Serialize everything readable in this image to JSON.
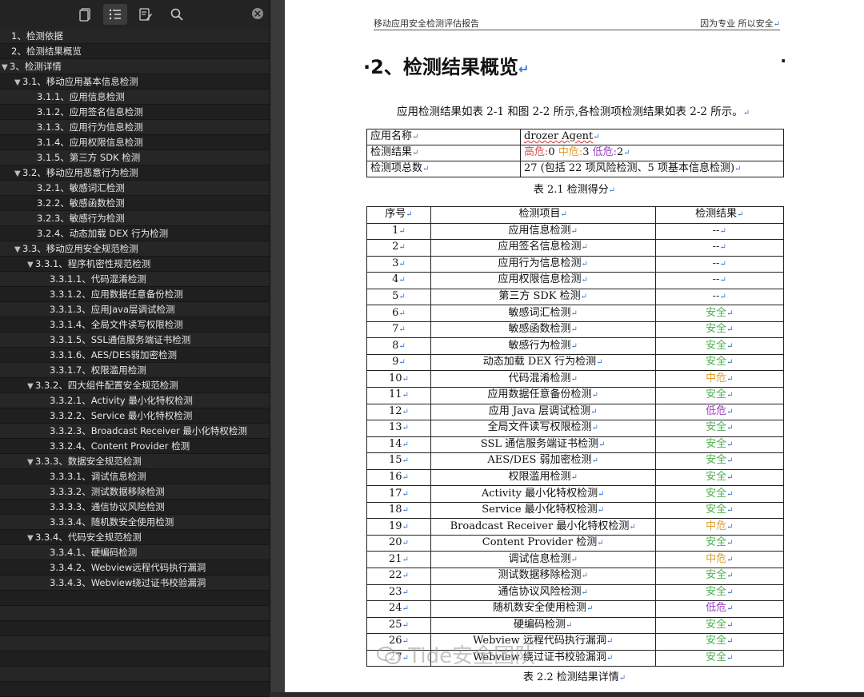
{
  "toolbar": {
    "icons": [
      "thumbnails-icon",
      "outline-icon",
      "annotations-icon",
      "search-icon"
    ],
    "active": "outline-icon"
  },
  "outline": [
    {
      "label": "1、检测依据",
      "level": 0,
      "caret": ""
    },
    {
      "label": "2、检测结果概览",
      "level": 0,
      "caret": ""
    },
    {
      "label": "3、检测详情",
      "level": 0,
      "caret": "▼"
    },
    {
      "label": "3.1、移动应用基本信息检测",
      "level": 1,
      "caret": "▼"
    },
    {
      "label": "3.1.1、应用信息检测",
      "level": 2,
      "caret": ""
    },
    {
      "label": "3.1.2、应用签名信息检测",
      "level": 2,
      "caret": ""
    },
    {
      "label": "3.1.3、应用行为信息检测",
      "level": 2,
      "caret": ""
    },
    {
      "label": "3.1.4、应用权限信息检测",
      "level": 2,
      "caret": ""
    },
    {
      "label": "3.1.5、第三方 SDK 检测",
      "level": 2,
      "caret": ""
    },
    {
      "label": "3.2、移动应用恶意行为检测",
      "level": 1,
      "caret": "▼"
    },
    {
      "label": "3.2.1、敏感词汇检测",
      "level": 2,
      "caret": ""
    },
    {
      "label": "3.2.2、敏感函数检测",
      "level": 2,
      "caret": ""
    },
    {
      "label": "3.2.3、敏感行为检测",
      "level": 2,
      "caret": ""
    },
    {
      "label": "3.2.4、动态加载 DEX 行为检测",
      "level": 2,
      "caret": ""
    },
    {
      "label": "3.3、移动应用安全规范检测",
      "level": 1,
      "caret": "▼"
    },
    {
      "label": "3.3.1、程序机密性规范检测",
      "level": 2,
      "caret": "▼"
    },
    {
      "label": "3.3.1.1、代码混淆检测",
      "level": 3,
      "caret": ""
    },
    {
      "label": "3.3.1.2、应用数据任意备份检测",
      "level": 3,
      "caret": ""
    },
    {
      "label": "3.3.1.3、应用Java层调试检测",
      "level": 3,
      "caret": ""
    },
    {
      "label": "3.3.1.4、全局文件读写权限检测",
      "level": 3,
      "caret": ""
    },
    {
      "label": "3.3.1.5、SSL通信服务端证书检测",
      "level": 3,
      "caret": ""
    },
    {
      "label": "3.3.1.6、AES/DES弱加密检测",
      "level": 3,
      "caret": ""
    },
    {
      "label": "3.3.1.7、权限滥用检测",
      "level": 3,
      "caret": ""
    },
    {
      "label": "3.3.2、四大组件配置安全规范检测",
      "level": 2,
      "caret": "▼"
    },
    {
      "label": "3.3.2.1、Activity 最小化特权检测",
      "level": 3,
      "caret": ""
    },
    {
      "label": "3.3.2.2、Service 最小化特权检测",
      "level": 3,
      "caret": ""
    },
    {
      "label": "3.3.2.3、Broadcast Receiver 最小化特权检测",
      "level": 3,
      "caret": ""
    },
    {
      "label": "3.3.2.4、Content Provider 检测",
      "level": 3,
      "caret": ""
    },
    {
      "label": "3.3.3、数据安全规范检测",
      "level": 2,
      "caret": "▼"
    },
    {
      "label": "3.3.3.1、调试信息检测",
      "level": 3,
      "caret": ""
    },
    {
      "label": "3.3.3.2、测试数据移除检测",
      "level": 3,
      "caret": ""
    },
    {
      "label": "3.3.3.3、通信协议风险检测",
      "level": 3,
      "caret": ""
    },
    {
      "label": "3.3.3.4、随机数安全使用检测",
      "level": 3,
      "caret": ""
    },
    {
      "label": "3.3.4、代码安全规范检测",
      "level": 2,
      "caret": "▼"
    },
    {
      "label": "3.3.4.1、硬编码检测",
      "level": 3,
      "caret": ""
    },
    {
      "label": "3.3.4.2、Webview远程代码执行漏洞",
      "level": 3,
      "caret": ""
    },
    {
      "label": "3.3.4.3、Webview绕过证书校验漏洞",
      "level": 3,
      "caret": ""
    },
    {
      "label": "",
      "level": 0,
      "caret": ""
    },
    {
      "label": "",
      "level": 0,
      "caret": ""
    },
    {
      "label": "",
      "level": 0,
      "caret": ""
    },
    {
      "label": "",
      "level": 0,
      "caret": ""
    },
    {
      "label": "",
      "level": 0,
      "caret": ""
    },
    {
      "label": "",
      "level": 0,
      "caret": ""
    },
    {
      "label": "",
      "level": 0,
      "caret": ""
    }
  ],
  "doc": {
    "header_left": "移动应用安全检测评估报告",
    "header_right": "因为专业 所以安全",
    "title": "·2、检测结果概览",
    "title_right_dot": "·",
    "intro": "应用检测结果如表 2-1 和图 2-2 所示,各检测项检测结果如表 2-2 所示。",
    "summary": {
      "app_name_label": "应用名称",
      "app_name_value": "drozer Agent",
      "result_label": "检测结果",
      "high_label": "高危:",
      "high_value": "0",
      "mid_label": "中危:",
      "mid_value": "3",
      "low_label": "低危:",
      "low_value": "2",
      "total_label": "检测项总数",
      "total_value": "27 (包括 22 项风险检测、5 项基本信息检测)"
    },
    "caption1": "表 2.1 检测得分",
    "detail_headers": [
      "序号",
      "检测项目",
      "检测结果"
    ],
    "detail_rows": [
      {
        "no": "1",
        "item": "应用信息检测",
        "result": "--"
      },
      {
        "no": "2",
        "item": "应用签名信息检测",
        "result": "--"
      },
      {
        "no": "3",
        "item": "应用行为信息检测",
        "result": "--"
      },
      {
        "no": "4",
        "item": "应用权限信息检测",
        "result": "--"
      },
      {
        "no": "5",
        "item": "第三方 SDK 检测",
        "result": "--"
      },
      {
        "no": "6",
        "item": "敏感词汇检测",
        "result": "安全"
      },
      {
        "no": "7",
        "item": "敏感函数检测",
        "result": "安全"
      },
      {
        "no": "8",
        "item": "敏感行为检测",
        "result": "安全"
      },
      {
        "no": "9",
        "item": "动态加载 DEX 行为检测",
        "result": "安全"
      },
      {
        "no": "10",
        "item": "代码混淆检测",
        "result": "中危"
      },
      {
        "no": "11",
        "item": "应用数据任意备份检测",
        "result": "安全"
      },
      {
        "no": "12",
        "item": "应用 Java 层调试检测",
        "result": "低危"
      },
      {
        "no": "13",
        "item": "全局文件读写权限检测",
        "result": "安全"
      },
      {
        "no": "14",
        "item": "SSL 通信服务端证书检测",
        "result": "安全"
      },
      {
        "no": "15",
        "item": "AES/DES 弱加密检测",
        "result": "安全"
      },
      {
        "no": "16",
        "item": "权限滥用检测",
        "result": "安全"
      },
      {
        "no": "17",
        "item": "Activity 最小化特权检测",
        "result": "安全"
      },
      {
        "no": "18",
        "item": "Service 最小化特权检测",
        "result": "安全"
      },
      {
        "no": "19",
        "item": "Broadcast Receiver 最小化特权检测",
        "result": "中危"
      },
      {
        "no": "20",
        "item": "Content Provider 检测",
        "result": "安全"
      },
      {
        "no": "21",
        "item": "调试信息检测",
        "result": "中危"
      },
      {
        "no": "22",
        "item": "测试数据移除检测",
        "result": "安全"
      },
      {
        "no": "23",
        "item": "通信协议风险检测",
        "result": "安全"
      },
      {
        "no": "24",
        "item": "随机数安全使用检测",
        "result": "低危"
      },
      {
        "no": "25",
        "item": "硬编码检测",
        "result": "安全"
      },
      {
        "no": "26",
        "item": "Webview 远程代码执行漏洞",
        "result": "安全"
      },
      {
        "no": "27",
        "item": "Webview 绕过证书校验漏洞",
        "result": "安全"
      }
    ],
    "caption2": "表 2.2 检测结果详情",
    "watermark": "Tide安全团队"
  },
  "colors": {
    "high": "#d9534f",
    "mid": "#e0a030",
    "low": "#9b3fbf",
    "safe": "#4caf50",
    "none": "#333333"
  }
}
